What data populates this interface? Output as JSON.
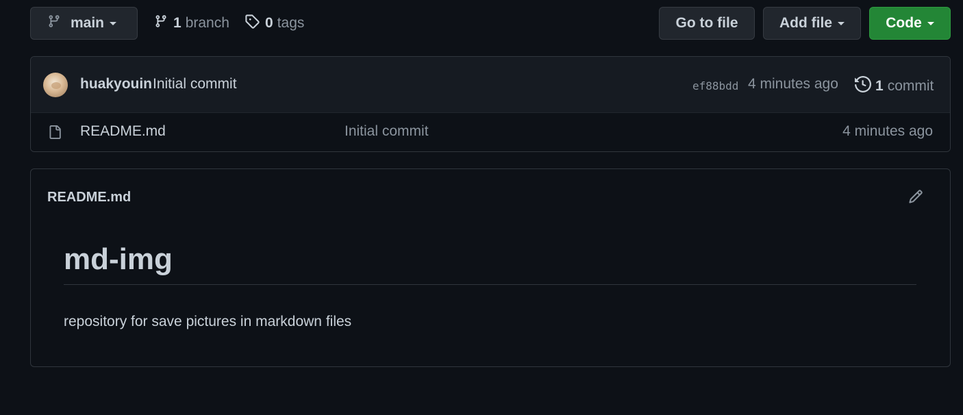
{
  "toolbar": {
    "branch_name": "main",
    "branch_count": "1",
    "branch_label": "branch",
    "tag_count": "0",
    "tag_label": "tags",
    "go_to_file": "Go to file",
    "add_file": "Add file",
    "code": "Code"
  },
  "latest_commit": {
    "author": "huakyouin",
    "message": "Initial commit",
    "sha": "ef88bdd",
    "time": "4 minutes ago",
    "commit_count": "1",
    "commit_label": "commit"
  },
  "files": [
    {
      "name": "README.md",
      "commit_message": "Initial commit",
      "time": "4 minutes ago"
    }
  ],
  "readme": {
    "file_title": "README.md",
    "heading": "md-img",
    "body": "repository for save pictures in markdown files"
  },
  "colors": {
    "background": "#0d1117",
    "code_button": "#238636",
    "muted_text": "#8b949e"
  },
  "icons": {
    "branch": "git-branch-icon",
    "tag": "tag-icon",
    "history": "history-icon",
    "file": "file-icon",
    "edit": "pencil-icon"
  }
}
